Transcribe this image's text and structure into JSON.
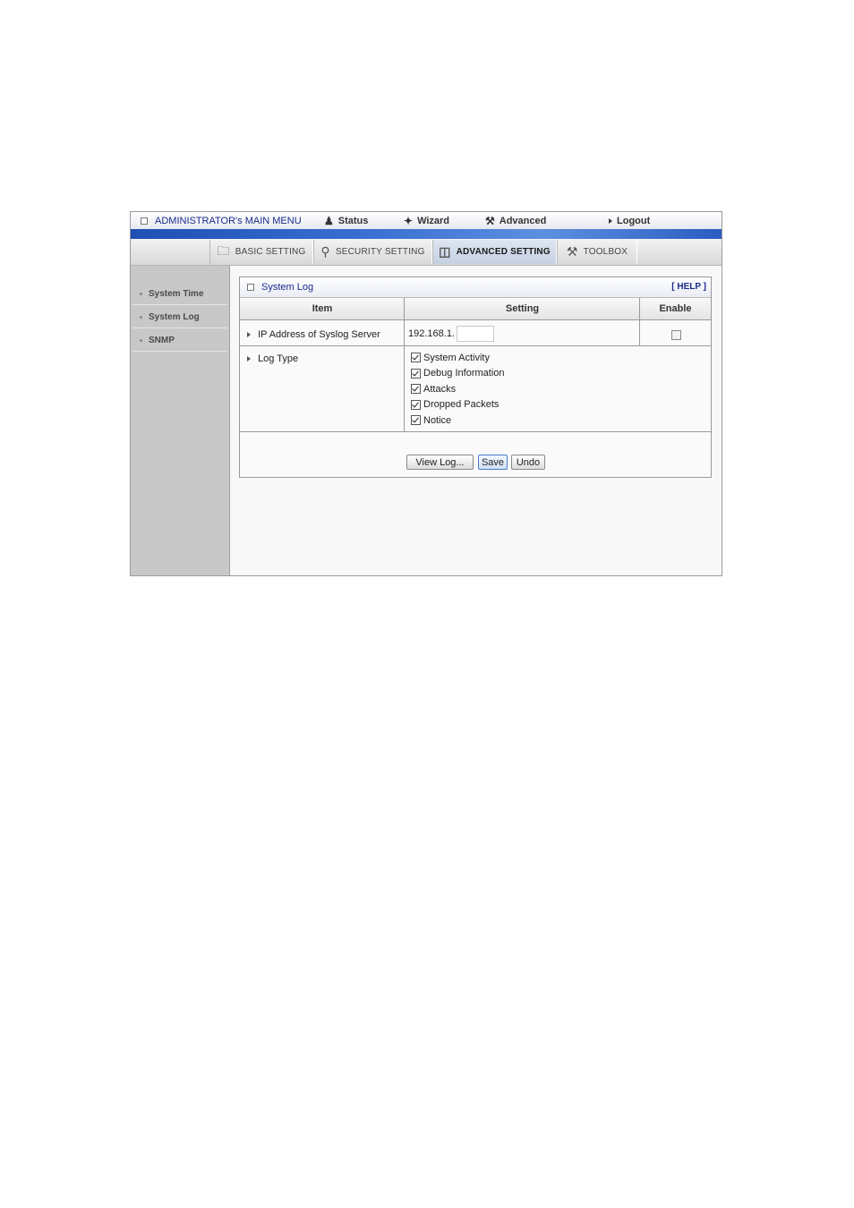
{
  "top_menu": {
    "admin_label": "ADMINISTRATOR's MAIN MENU",
    "status": "Status",
    "wizard": "Wizard",
    "advanced": "Advanced",
    "logout": "Logout"
  },
  "tabs": [
    {
      "label": "BASIC SETTING",
      "active": false
    },
    {
      "label": "SECURITY SETTING",
      "active": false
    },
    {
      "label": "ADVANCED SETTING",
      "active": true
    },
    {
      "label": "TOOLBOX",
      "active": false
    }
  ],
  "sidebar": {
    "items": [
      {
        "label": "System Time"
      },
      {
        "label": "System Log"
      },
      {
        "label": "SNMP"
      }
    ]
  },
  "panel": {
    "title": "System Log",
    "help": "[ HELP ]",
    "headers": {
      "item": "Item",
      "setting": "Setting",
      "enable": "Enable"
    },
    "ip_row": {
      "label": "IP Address of Syslog Server",
      "prefix": "192.168.1.",
      "value": "",
      "enabled": false
    },
    "log_type": {
      "label": "Log Type",
      "options": [
        {
          "label": "System Activity",
          "checked": true
        },
        {
          "label": "Debug Information",
          "checked": true
        },
        {
          "label": "Attacks",
          "checked": true
        },
        {
          "label": "Dropped Packets",
          "checked": true
        },
        {
          "label": "Notice",
          "checked": true
        }
      ]
    },
    "buttons": {
      "view_log": "View Log...",
      "save": "Save",
      "undo": "Undo"
    }
  }
}
